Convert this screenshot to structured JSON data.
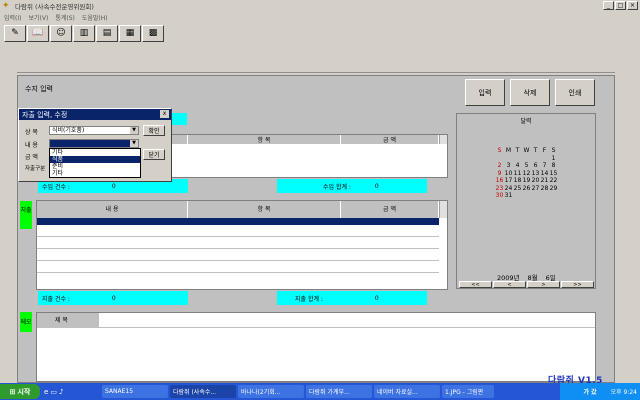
{
  "window": {
    "title": "다람쥐 (사속수전운영위원회)"
  },
  "menu": [
    "입력(I)",
    "보기(V)",
    "통계(S)",
    "도움말(H)"
  ],
  "toolbar_icons": [
    "edit-icon",
    "book-icon",
    "user-icon",
    "chart-icon",
    "document-icon",
    "report-icon",
    "calculator-icon"
  ],
  "page": {
    "label": "수지 입력"
  },
  "actions": {
    "input": "입력",
    "delete": "삭제",
    "print": "인쇄"
  },
  "income": {
    "columns": [
      "내 용",
      "항 목",
      "금 액"
    ],
    "count_label": "수입 건수 :",
    "count_value": "0",
    "sum_label": "수입 합계 :",
    "sum_value": "0"
  },
  "expense": {
    "tag": "지출",
    "columns": [
      "내 용",
      "항 목",
      "금 액"
    ],
    "count_label": "지출 건수 :",
    "count_value": "0",
    "sum_label": "지출 합계 :",
    "sum_value": "0"
  },
  "memo": {
    "tag": "메모",
    "title_label": "제 목",
    "title_value": ""
  },
  "calendar": {
    "header": "달력",
    "weekdays": [
      "S",
      "M",
      "T",
      "W",
      "T",
      "F",
      "S"
    ],
    "weeks": [
      [
        "",
        "",
        "",
        "",
        "",
        "",
        "1"
      ],
      [
        "2",
        "3",
        "4",
        "5",
        "6",
        "7",
        "8"
      ],
      [
        "9",
        "10",
        "11",
        "12",
        "13",
        "14",
        "15"
      ],
      [
        "16",
        "17",
        "18",
        "19",
        "20",
        "21",
        "22"
      ],
      [
        "23",
        "24",
        "25",
        "26",
        "27",
        "28",
        "29"
      ],
      [
        "30",
        "31",
        "",
        "",
        "",
        "",
        ""
      ]
    ],
    "year": "2009년",
    "month": "8월",
    "day": "6일",
    "nav": [
      "<<",
      "<",
      ">",
      ">>"
    ]
  },
  "dialog": {
    "title": "자출 입력, 수정",
    "close": "x",
    "label_type": "상 목",
    "type_value": "식비(기호품)",
    "confirm": "확인",
    "label_content": "내 용",
    "content_value": "",
    "label_amount": "금 액",
    "close_button": "닫기",
    "label_category": "자출구분",
    "options": [
      "기타",
      "식품",
      "준비",
      "기타"
    ],
    "selected_option_index": 1
  },
  "brand": "다람쥐 V1.5",
  "taskbar": {
    "start": "시작",
    "tasks": [
      "SANAE15",
      "다람쥐 (사속수...",
      "바나나(2기회...",
      "다람쥐 가계부...",
      "네이버 자료실...",
      "1.JPG - 그림판"
    ],
    "tray_text": "가 갔",
    "time": "오후 9:24"
  }
}
